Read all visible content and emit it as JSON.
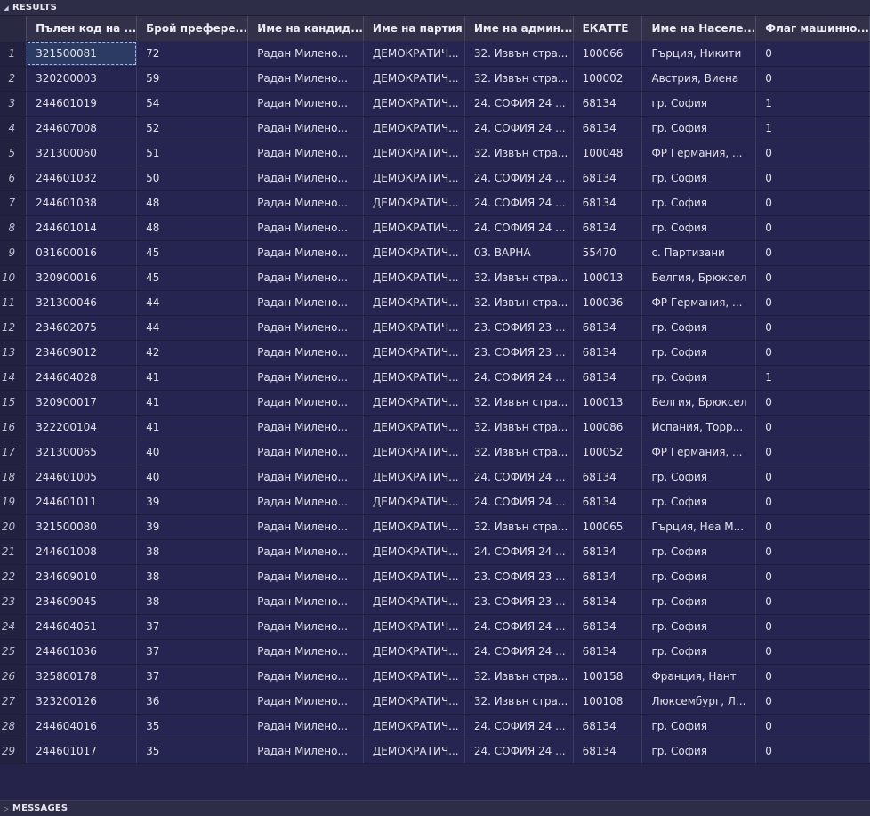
{
  "panels": {
    "results_label": "RESULTS",
    "messages_label": "MESSAGES"
  },
  "columns": [
    "Пълен код на ...",
    "Брой префере...",
    "Име на кандид...",
    "Име на партия",
    "Име на админ...",
    "ЕКАТТЕ",
    "Име на Населе...",
    "Флаг машинно..."
  ],
  "rows": [
    [
      "1",
      "321500081",
      "72",
      "Радан Милено...",
      "ДЕМОКРАТИЧ...",
      "32. Извън стра...",
      "100066",
      "Гърция, Никити",
      "0"
    ],
    [
      "2",
      "320200003",
      "59",
      "Радан Милено...",
      "ДЕМОКРАТИЧ...",
      "32. Извън стра...",
      "100002",
      "Австрия, Виена",
      "0"
    ],
    [
      "3",
      "244601019",
      "54",
      "Радан Милено...",
      "ДЕМОКРАТИЧ...",
      "24. СОФИЯ 24 ...",
      "68134",
      "гр. София",
      "1"
    ],
    [
      "4",
      "244607008",
      "52",
      "Радан Милено...",
      "ДЕМОКРАТИЧ...",
      "24. СОФИЯ 24 ...",
      "68134",
      "гр. София",
      "1"
    ],
    [
      "5",
      "321300060",
      "51",
      "Радан Милено...",
      "ДЕМОКРАТИЧ...",
      "32. Извън стра...",
      "100048",
      "ФР Германия, ...",
      "0"
    ],
    [
      "6",
      "244601032",
      "50",
      "Радан Милено...",
      "ДЕМОКРАТИЧ...",
      "24. СОФИЯ 24 ...",
      "68134",
      "гр. София",
      "0"
    ],
    [
      "7",
      "244601038",
      "48",
      "Радан Милено...",
      "ДЕМОКРАТИЧ...",
      "24. СОФИЯ 24 ...",
      "68134",
      "гр. София",
      "0"
    ],
    [
      "8",
      "244601014",
      "48",
      "Радан Милено...",
      "ДЕМОКРАТИЧ...",
      "24. СОФИЯ 24 ...",
      "68134",
      "гр. София",
      "0"
    ],
    [
      "9",
      "031600016",
      "45",
      "Радан Милено...",
      "ДЕМОКРАТИЧ...",
      "03. ВАРНА",
      "55470",
      "с. Партизани",
      "0"
    ],
    [
      "10",
      "320900016",
      "45",
      "Радан Милено...",
      "ДЕМОКРАТИЧ...",
      "32. Извън стра...",
      "100013",
      "Белгия, Брюксел",
      "0"
    ],
    [
      "11",
      "321300046",
      "44",
      "Радан Милено...",
      "ДЕМОКРАТИЧ...",
      "32. Извън стра...",
      "100036",
      "ФР Германия, ...",
      "0"
    ],
    [
      "12",
      "234602075",
      "44",
      "Радан Милено...",
      "ДЕМОКРАТИЧ...",
      "23. СОФИЯ 23 ...",
      "68134",
      "гр. София",
      "0"
    ],
    [
      "13",
      "234609012",
      "42",
      "Радан Милено...",
      "ДЕМОКРАТИЧ...",
      "23. СОФИЯ 23 ...",
      "68134",
      "гр. София",
      "0"
    ],
    [
      "14",
      "244604028",
      "41",
      "Радан Милено...",
      "ДЕМОКРАТИЧ...",
      "24. СОФИЯ 24 ...",
      "68134",
      "гр. София",
      "1"
    ],
    [
      "15",
      "320900017",
      "41",
      "Радан Милено...",
      "ДЕМОКРАТИЧ...",
      "32. Извън стра...",
      "100013",
      "Белгия, Брюксел",
      "0"
    ],
    [
      "16",
      "322200104",
      "41",
      "Радан Милено...",
      "ДЕМОКРАТИЧ...",
      "32. Извън стра...",
      "100086",
      "Испания, Торр...",
      "0"
    ],
    [
      "17",
      "321300065",
      "40",
      "Радан Милено...",
      "ДЕМОКРАТИЧ...",
      "32. Извън стра...",
      "100052",
      "ФР Германия, ...",
      "0"
    ],
    [
      "18",
      "244601005",
      "40",
      "Радан Милено...",
      "ДЕМОКРАТИЧ...",
      "24. СОФИЯ 24 ...",
      "68134",
      "гр. София",
      "0"
    ],
    [
      "19",
      "244601011",
      "39",
      "Радан Милено...",
      "ДЕМОКРАТИЧ...",
      "24. СОФИЯ 24 ...",
      "68134",
      "гр. София",
      "0"
    ],
    [
      "20",
      "321500080",
      "39",
      "Радан Милено...",
      "ДЕМОКРАТИЧ...",
      "32. Извън стра...",
      "100065",
      "Гърция, Неа М...",
      "0"
    ],
    [
      "21",
      "244601008",
      "38",
      "Радан Милено...",
      "ДЕМОКРАТИЧ...",
      "24. СОФИЯ 24 ...",
      "68134",
      "гр. София",
      "0"
    ],
    [
      "22",
      "234609010",
      "38",
      "Радан Милено...",
      "ДЕМОКРАТИЧ...",
      "23. СОФИЯ 23 ...",
      "68134",
      "гр. София",
      "0"
    ],
    [
      "23",
      "234609045",
      "38",
      "Радан Милено...",
      "ДЕМОКРАТИЧ...",
      "23. СОФИЯ 23 ...",
      "68134",
      "гр. София",
      "0"
    ],
    [
      "24",
      "244604051",
      "37",
      "Радан Милено...",
      "ДЕМОКРАТИЧ...",
      "24. СОФИЯ 24 ...",
      "68134",
      "гр. София",
      "0"
    ],
    [
      "25",
      "244601036",
      "37",
      "Радан Милено...",
      "ДЕМОКРАТИЧ...",
      "24. СОФИЯ 24 ...",
      "68134",
      "гр. София",
      "0"
    ],
    [
      "26",
      "325800178",
      "37",
      "Радан Милено...",
      "ДЕМОКРАТИЧ...",
      "32. Извън стра...",
      "100158",
      "Франция, Нант",
      "0"
    ],
    [
      "27",
      "323200126",
      "36",
      "Радан Милено...",
      "ДЕМОКРАТИЧ...",
      "32. Извън стра...",
      "100108",
      "Люксембург, Л...",
      "0"
    ],
    [
      "28",
      "244604016",
      "35",
      "Радан Милено...",
      "ДЕМОКРАТИЧ...",
      "24. СОФИЯ 24 ...",
      "68134",
      "гр. София",
      "0"
    ],
    [
      "29",
      "244601017",
      "35",
      "Радан Милено...",
      "ДЕМОКРАТИЧ...",
      "24. СОФИЯ 24 ...",
      "68134",
      "гр. София",
      "0"
    ]
  ],
  "icons": {
    "results_toggle": "collapse-triangle-icon",
    "messages_toggle": "expand-triangle-icon"
  }
}
